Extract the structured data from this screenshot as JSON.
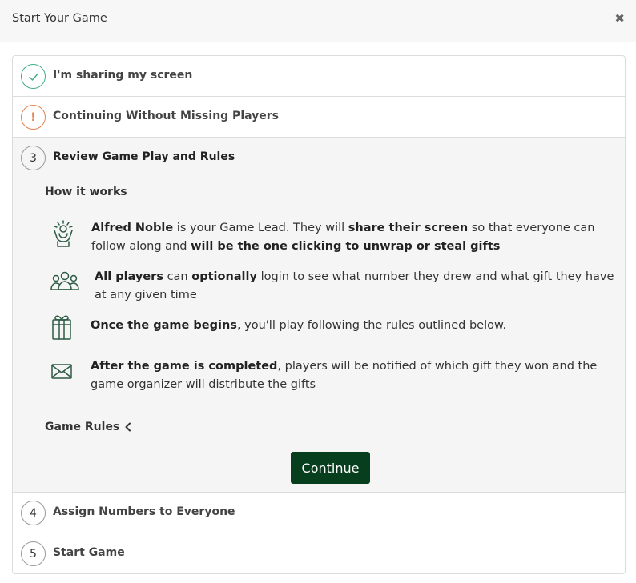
{
  "modal": {
    "title": "Start Your Game",
    "close_glyph": "✖"
  },
  "steps": [
    {
      "number": "✓",
      "label": "I'm sharing my screen",
      "state": "done"
    },
    {
      "number": "!",
      "label": "Continuing Without Missing Players",
      "state": "warning"
    },
    {
      "number": "3",
      "label": "Review Game Play and Rules",
      "state": "active"
    },
    {
      "number": "4",
      "label": "Assign Numbers to Everyone",
      "state": "pending"
    },
    {
      "number": "5",
      "label": "Start Game",
      "state": "pending"
    }
  ],
  "how_it_works": {
    "title": "How it works",
    "items": [
      {
        "icon": "game-lead-icon",
        "parts": [
          {
            "t": "Alfred Noble",
            "b": true
          },
          {
            "t": " is your Game Lead. They will ",
            "b": false
          },
          {
            "t": "share their screen",
            "b": true
          },
          {
            "t": " so that everyone can follow along and ",
            "b": false
          },
          {
            "t": "will be the one clicking to unwrap or steal gifts",
            "b": true
          }
        ]
      },
      {
        "icon": "players-group-icon",
        "parts": [
          {
            "t": "All players",
            "b": true
          },
          {
            "t": " can ",
            "b": false
          },
          {
            "t": "optionally",
            "b": true
          },
          {
            "t": " login to see what number they drew and what gift they have at any given time",
            "b": false
          }
        ]
      },
      {
        "icon": "gift-icon",
        "parts": [
          {
            "t": "Once the game begins",
            "b": true
          },
          {
            "t": ", you'll play following the rules outlined below.",
            "b": false
          }
        ]
      },
      {
        "icon": "envelope-icon",
        "parts": [
          {
            "t": "After the game is completed",
            "b": true
          },
          {
            "t": ", players will be notified of which gift they won and the game organizer will distribute the gifts",
            "b": false
          }
        ]
      }
    ]
  },
  "rules": {
    "label": "Game Rules"
  },
  "continue_label": "Continue",
  "colors": {
    "done": "#3fae87",
    "warning": "#e2824f",
    "primary_button": "#073f1e",
    "icon_stroke": "#2d5b45"
  }
}
